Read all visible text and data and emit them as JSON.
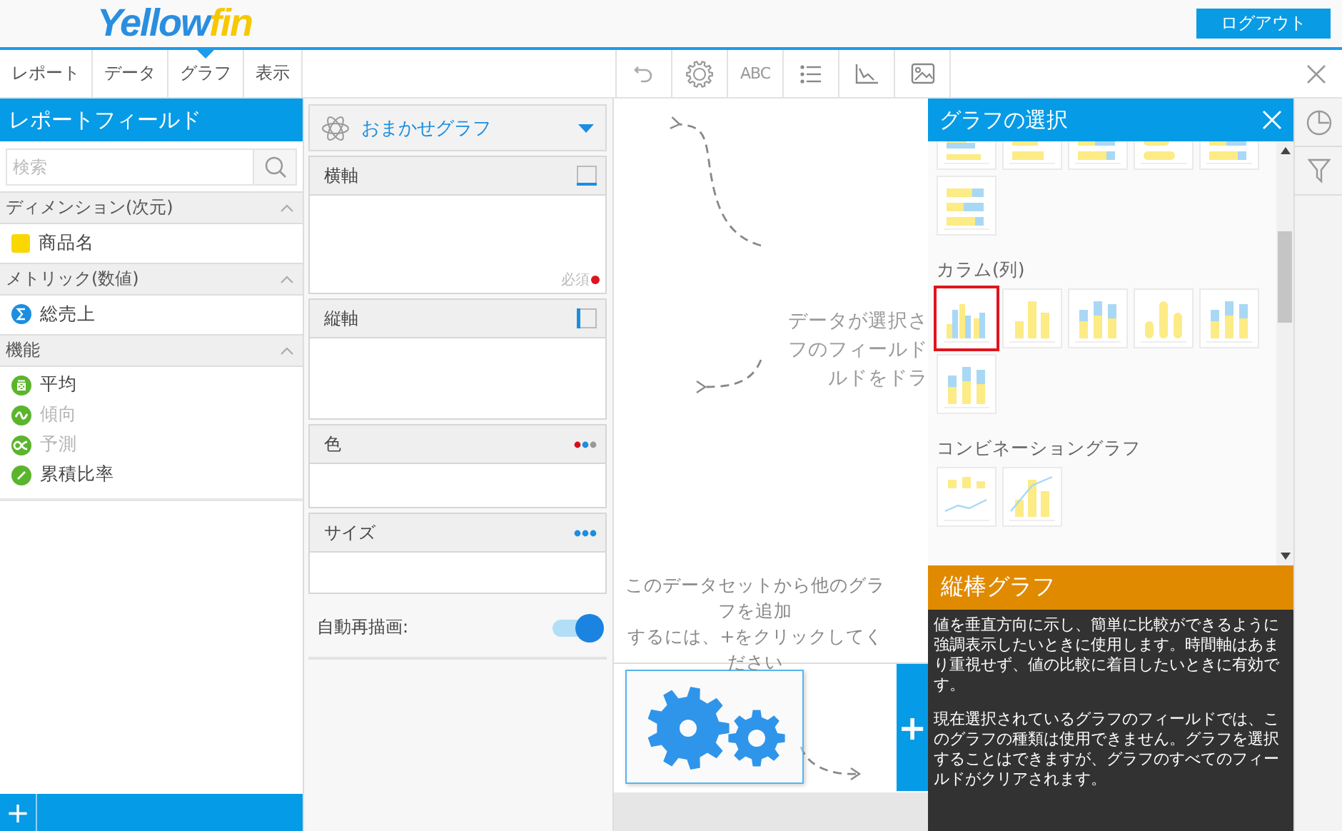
{
  "logo": {
    "main": "Yellow",
    "accent": "fin"
  },
  "logout_button": "ログアウト",
  "tabs": [
    {
      "label": "レポート",
      "selected": false
    },
    {
      "label": "データ",
      "selected": false
    },
    {
      "label": "グラフ",
      "selected": true
    },
    {
      "label": "表示",
      "selected": false
    }
  ],
  "toolbar": [
    {
      "kind": "undo"
    },
    {
      "kind": "settings"
    },
    {
      "kind": "text",
      "label": "ABC"
    },
    {
      "kind": "list"
    },
    {
      "kind": "axes"
    },
    {
      "kind": "image"
    }
  ],
  "report_fields": {
    "title": "レポートフィールド",
    "search": {
      "placeholder": "検索"
    },
    "sections": [
      {
        "title": "ディメンション(次元)",
        "expanded": true,
        "items": [
          {
            "label": "商品名",
            "kind": "dimension",
            "disabled": false
          }
        ]
      },
      {
        "title": "メトリック(数値)",
        "expanded": true,
        "items": [
          {
            "label": "総売上",
            "kind": "metric",
            "disabled": false
          }
        ]
      },
      {
        "title": "機能",
        "expanded": true,
        "items": [
          {
            "label": "平均",
            "kind": "average",
            "disabled": false
          },
          {
            "label": "傾向",
            "kind": "trend",
            "disabled": true
          },
          {
            "label": "予測",
            "kind": "forecast",
            "disabled": true
          },
          {
            "label": "累積比率",
            "kind": "cumulative",
            "disabled": false
          }
        ]
      }
    ],
    "add_button": "+"
  },
  "chart_builder": {
    "chart_type": "おまかせグラフ",
    "zones": [
      {
        "label": "横軸",
        "kind": "x-axis",
        "required": true,
        "required_label": "必須"
      },
      {
        "label": "縦軸",
        "kind": "y-axis",
        "required": false
      },
      {
        "label": "色",
        "kind": "color",
        "required": false
      },
      {
        "label": "サイズ",
        "kind": "size",
        "required": false
      }
    ],
    "auto_redraw": {
      "label": "自動再描画:",
      "on": true
    }
  },
  "canvas": {
    "drop_hint": [
      "データが選択さ",
      "フのフィールド",
      "ルドをドラ"
    ],
    "add_hint": [
      "このデータセットから他のグラフを追加",
      "するには、+をクリックしてください"
    ],
    "add_button": "+"
  },
  "chart_picker": {
    "title": "グラフの選択",
    "groups": [
      {
        "items": [
          {
            "kind": "hbar",
            "selected": false
          },
          {
            "kind": "hbar-single",
            "selected": false
          },
          {
            "kind": "hbar-stacked",
            "selected": false
          },
          {
            "kind": "hbar-cylinder",
            "selected": false
          },
          {
            "kind": "hbar-stacked",
            "selected": false
          },
          {
            "kind": "hbar-stacked",
            "selected": false
          }
        ]
      },
      {
        "title": "カラム(列)",
        "items": [
          {
            "kind": "column",
            "selected": true
          },
          {
            "kind": "column-single",
            "selected": false
          },
          {
            "kind": "column-stacked",
            "selected": false
          },
          {
            "kind": "column-cylinder",
            "selected": false
          },
          {
            "kind": "column-stacked",
            "selected": false
          },
          {
            "kind": "column-stacked",
            "selected": false
          }
        ]
      },
      {
        "title": "コンビネーショングラフ",
        "items": [
          {
            "kind": "combo-line",
            "selected": false
          },
          {
            "kind": "combo-bar-line",
            "selected": false
          }
        ]
      }
    ],
    "detail": {
      "title": "縦棒グラフ",
      "paragraphs": [
        "値を垂直方向に示し、簡単に比較ができるように強調表示したいときに使用します。時間軸はあまり重視せず、値の比較に着目したいときに有効です。",
        "現在選択されているグラフのフィールドでは、このグラフの種類は使用できません。グラフを選択することはできますが、グラフのすべてのフィールドがクリアされます。"
      ]
    }
  }
}
